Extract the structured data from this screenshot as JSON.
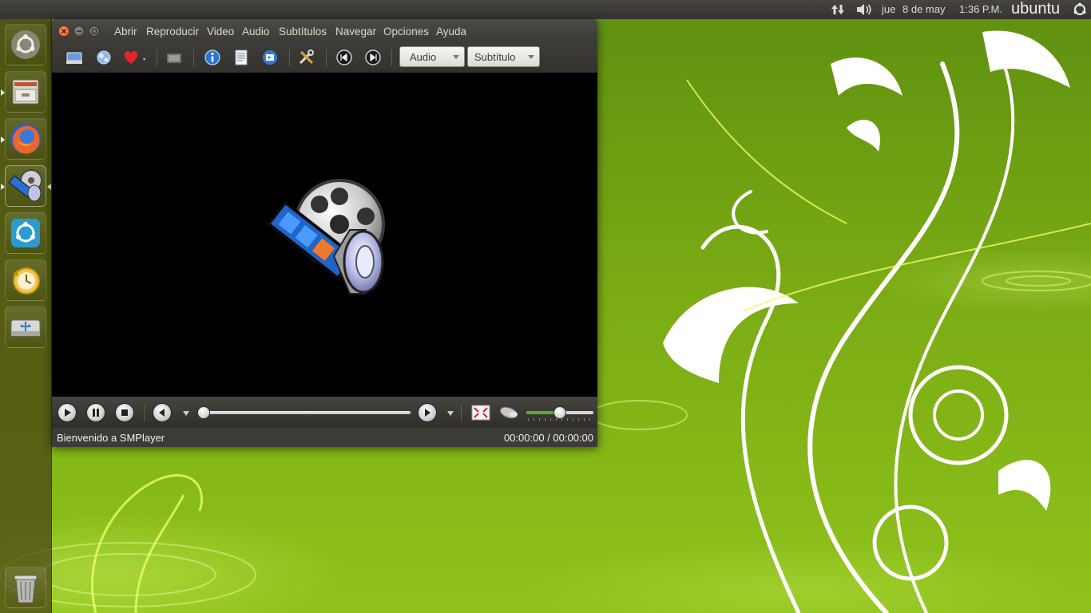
{
  "top_panel": {
    "day": "jue",
    "date": "8 de may",
    "time": "1:36 P.M.",
    "logo": "ubuntu",
    "icons": [
      "network-updown-icon",
      "volume-icon",
      "ubuntu-power-icon"
    ]
  },
  "launcher": {
    "items": [
      "ubuntu-dash-icon",
      "file-manager-icon",
      "firefox-icon",
      "smplayer-icon",
      "software-updater-icon",
      "backup-icon",
      "usb-creator-icon",
      "trash-icon"
    ]
  },
  "window": {
    "menu": [
      "Abrir",
      "Reproducir",
      "Video",
      "Audio",
      "Subtítulos",
      "Navegar",
      "Opciones",
      "Ayuda"
    ],
    "toolbar": {
      "icons": [
        "open-icon",
        "network-icon",
        "favorites-icon",
        "screenshot-icon",
        "info-icon",
        "playlist-icon",
        "preferences-icon",
        "tools-icon",
        "previous-chapter-icon",
        "next-chapter-icon"
      ],
      "audio_combo": "Audio",
      "subtitle_combo": "Subtítulo"
    },
    "controls": {
      "icons": [
        "play-icon",
        "pause-icon",
        "stop-icon",
        "rewind-icon",
        "forward-icon",
        "fullscreen-icon",
        "mute-icon"
      ],
      "volume_level": 0.5,
      "seek_position": 0.0
    },
    "status": {
      "message": "Bienvenido a SMPlayer",
      "time": "00:00:00 / 00:00:00"
    }
  },
  "colors": {
    "accent_green": "#7bab15",
    "close_orange": "#e9612c"
  }
}
